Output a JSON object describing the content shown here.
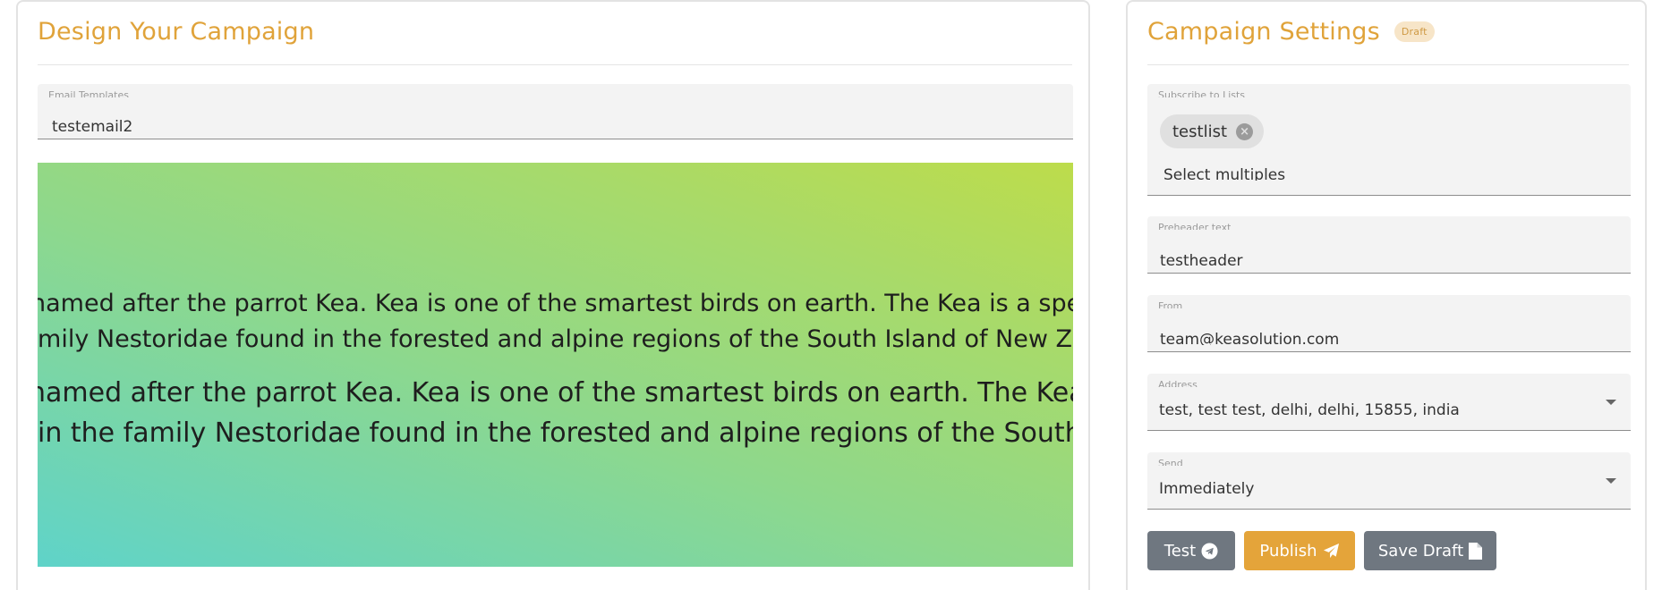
{
  "left_panel": {
    "title": "Design Your Campaign",
    "template_field": {
      "label": "Email Templates",
      "value": "testemail2"
    },
    "preview": {
      "lines": [
        "named after the parrot Kea. Kea is one of the smartest birds on earth. The Kea is a species",
        "family Nestoridae found in the forested and alpine regions of the South Island of New Zealand",
        "named after the parrot Kea. Kea is one of the smartest birds on earth. The Kea is a",
        "in the family Nestoridae found in the forested and alpine regions of the South Island"
      ]
    }
  },
  "right_panel": {
    "title": "Campaign Settings",
    "badge": "Draft",
    "lists_field": {
      "label": "Subscribe to Lists",
      "chip": "testlist",
      "placeholder": "Select multiples"
    },
    "preheader_field": {
      "label": "Preheader text",
      "value": "testheader"
    },
    "from_field": {
      "label": "From",
      "value": "team@keasolution.com"
    },
    "address_field": {
      "label": "Address",
      "value": "test, test test, delhi, delhi, 15855, india"
    },
    "send_field": {
      "label": "Send",
      "value": "Immediately"
    },
    "buttons": {
      "test": "Test",
      "publish": "Publish",
      "save_draft": "Save Draft"
    }
  },
  "colors": {
    "accent": "#e0a33a",
    "button_gray": "#6f7780",
    "button_gold": "#e4a43a"
  },
  "icons": [
    "close-circle-icon",
    "caret-down-icon",
    "telegram-icon",
    "paper-plane-icon",
    "file-icon"
  ]
}
